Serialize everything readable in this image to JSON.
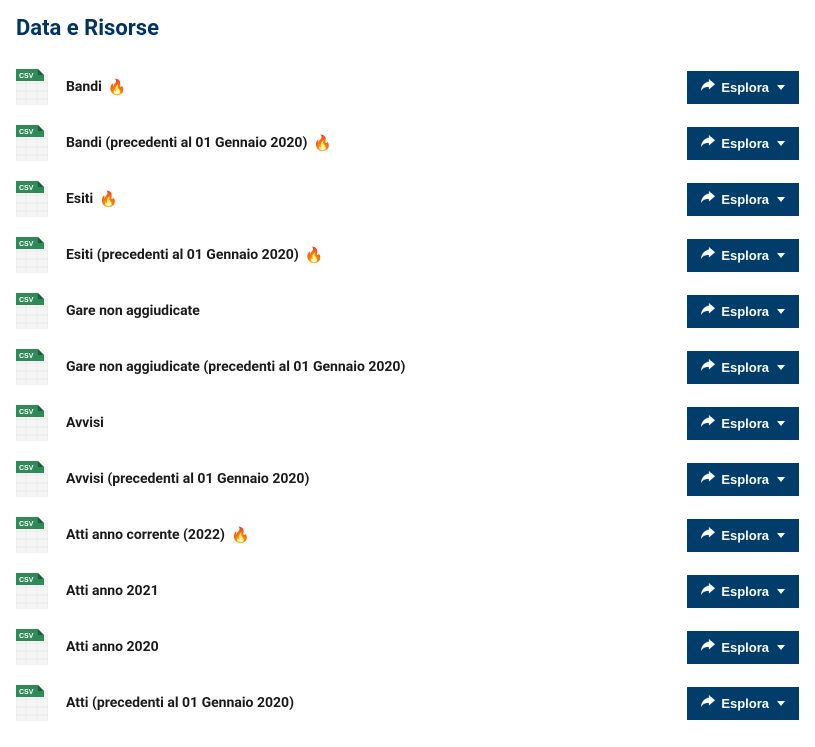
{
  "section_title": "Data e Risorse",
  "explore_label": "Esplora",
  "csv_badge": "CSV",
  "resources": [
    {
      "title": "Bandi",
      "hot": true
    },
    {
      "title": "Bandi (precedenti al 01 Gennaio 2020)",
      "hot": true
    },
    {
      "title": "Esiti",
      "hot": true
    },
    {
      "title": "Esiti (precedenti al 01 Gennaio 2020)",
      "hot": true
    },
    {
      "title": "Gare non aggiudicate",
      "hot": false
    },
    {
      "title": "Gare non aggiudicate (precedenti al 01 Gennaio 2020)",
      "hot": false
    },
    {
      "title": "Avvisi",
      "hot": false
    },
    {
      "title": "Avvisi (precedenti al 01 Gennaio 2020)",
      "hot": false
    },
    {
      "title": "Atti anno corrente (2022)",
      "hot": true
    },
    {
      "title": "Atti anno 2021",
      "hot": false
    },
    {
      "title": "Atti anno 2020",
      "hot": false
    },
    {
      "title": "Atti (precedenti al 01 Gennaio 2020)",
      "hot": false
    }
  ]
}
